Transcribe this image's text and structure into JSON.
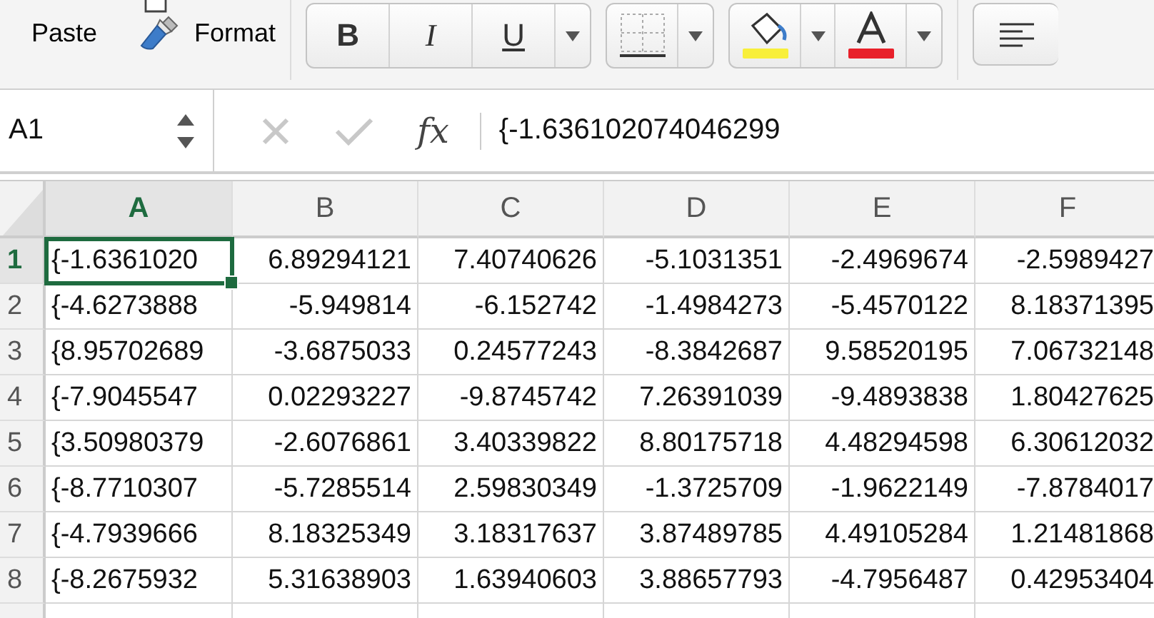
{
  "ribbon": {
    "paste_label": "Paste",
    "format_label": "Format",
    "font_style_buttons": [
      {
        "label": "B",
        "kind": "bold"
      },
      {
        "label": "I",
        "kind": "italic"
      },
      {
        "label": "U",
        "kind": "underline"
      }
    ]
  },
  "formula_bar": {
    "name_box": "A1",
    "fx_label": "fx",
    "value": "{-1.636102074046299"
  },
  "sheet": {
    "columns": [
      {
        "label": "A",
        "selected": true
      },
      {
        "label": "B",
        "selected": false
      },
      {
        "label": "C",
        "selected": false
      },
      {
        "label": "D",
        "selected": false
      },
      {
        "label": "E",
        "selected": false
      },
      {
        "label": "F",
        "selected": false
      }
    ],
    "rows": [
      {
        "label": "1",
        "selected": true,
        "cells": [
          {
            "text": "{-1.6361020",
            "selected": true
          },
          {
            "text": "6.89294121",
            "selected": false
          },
          {
            "text": "7.40740626",
            "selected": false
          },
          {
            "text": "-5.1031351",
            "selected": false
          },
          {
            "text": "-2.4969674",
            "selected": false
          },
          {
            "text": "-2.5989427",
            "selected": false
          }
        ]
      },
      {
        "label": "2",
        "selected": false,
        "cells": [
          {
            "text": "{-4.6273888",
            "selected": false
          },
          {
            "text": "-5.949814",
            "selected": false
          },
          {
            "text": "-6.152742",
            "selected": false
          },
          {
            "text": "-1.4984273",
            "selected": false
          },
          {
            "text": "-5.4570122",
            "selected": false
          },
          {
            "text": "8.18371395",
            "selected": false
          }
        ]
      },
      {
        "label": "3",
        "selected": false,
        "cells": [
          {
            "text": "{8.95702689",
            "selected": false
          },
          {
            "text": "-3.6875033",
            "selected": false
          },
          {
            "text": "0.24577243",
            "selected": false
          },
          {
            "text": "-8.3842687",
            "selected": false
          },
          {
            "text": "9.58520195",
            "selected": false
          },
          {
            "text": "7.06732148",
            "selected": false
          }
        ]
      },
      {
        "label": "4",
        "selected": false,
        "cells": [
          {
            "text": "{-7.9045547",
            "selected": false
          },
          {
            "text": "0.02293227",
            "selected": false
          },
          {
            "text": "-9.8745742",
            "selected": false
          },
          {
            "text": "7.26391039",
            "selected": false
          },
          {
            "text": "-9.4893838",
            "selected": false
          },
          {
            "text": "1.80427625",
            "selected": false
          }
        ]
      },
      {
        "label": "5",
        "selected": false,
        "cells": [
          {
            "text": "{3.50980379",
            "selected": false
          },
          {
            "text": "-2.6076861",
            "selected": false
          },
          {
            "text": "3.40339822",
            "selected": false
          },
          {
            "text": "8.80175718",
            "selected": false
          },
          {
            "text": "4.48294598",
            "selected": false
          },
          {
            "text": "6.30612032",
            "selected": false
          }
        ]
      },
      {
        "label": "6",
        "selected": false,
        "cells": [
          {
            "text": "{-8.7710307",
            "selected": false
          },
          {
            "text": "-5.7285514",
            "selected": false
          },
          {
            "text": "2.59830349",
            "selected": false
          },
          {
            "text": "-1.3725709",
            "selected": false
          },
          {
            "text": "-1.9622149",
            "selected": false
          },
          {
            "text": "-7.8784017",
            "selected": false
          }
        ]
      },
      {
        "label": "7",
        "selected": false,
        "cells": [
          {
            "text": "{-4.7939666",
            "selected": false
          },
          {
            "text": "8.18325349",
            "selected": false
          },
          {
            "text": "3.18317637",
            "selected": false
          },
          {
            "text": "3.87489785",
            "selected": false
          },
          {
            "text": "4.49105284",
            "selected": false
          },
          {
            "text": "1.21481868",
            "selected": false
          }
        ]
      },
      {
        "label": "8",
        "selected": false,
        "cells": [
          {
            "text": "{-8.2675932",
            "selected": false
          },
          {
            "text": "5.31638903",
            "selected": false
          },
          {
            "text": "1.63940603",
            "selected": false
          },
          {
            "text": "3.88657793",
            "selected": false
          },
          {
            "text": "-4.7956487",
            "selected": false
          },
          {
            "text": "0.42953404",
            "selected": false
          }
        ]
      }
    ]
  }
}
